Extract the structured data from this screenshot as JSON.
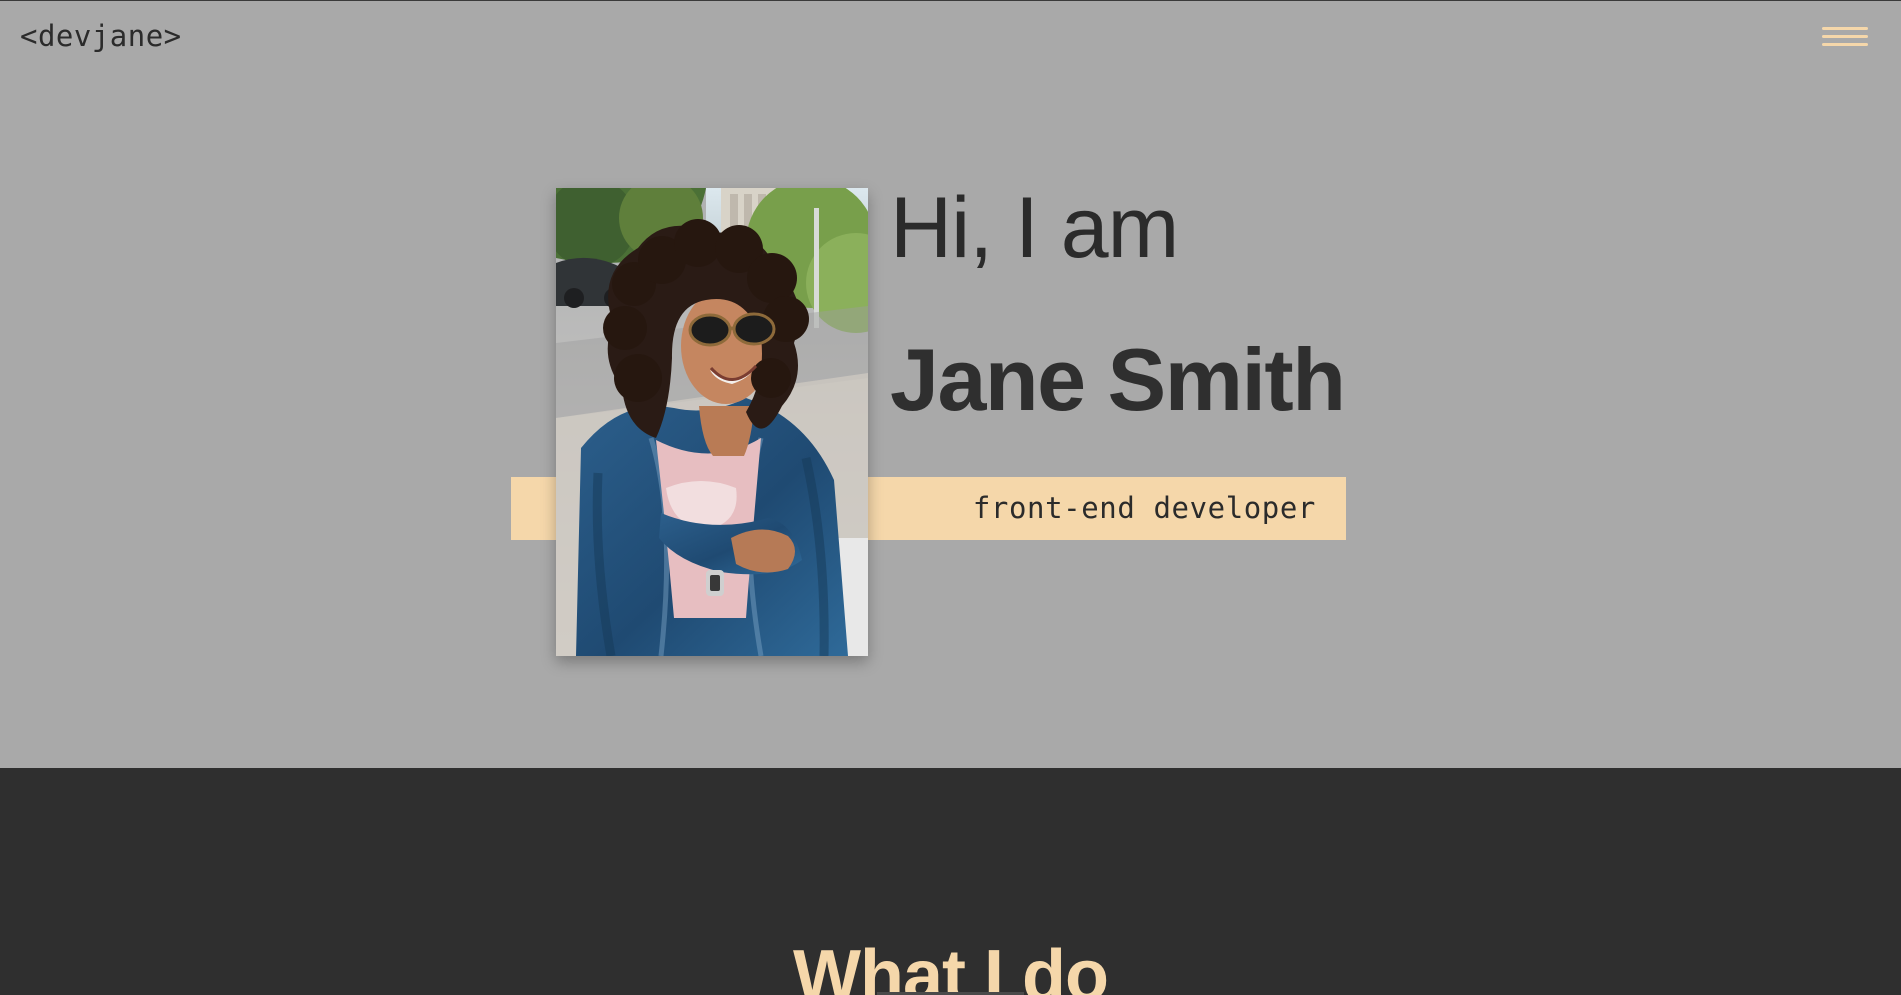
{
  "header": {
    "logo_text": "<devjane>",
    "menu_icon": "hamburger-menu-icon"
  },
  "hero": {
    "greeting": "Hi, I am",
    "name": "Jane Smith",
    "role": "front-end developer",
    "photo_alt": "Portrait of Jane Smith smiling outdoors wearing sunglasses and a denim jacket"
  },
  "services": {
    "title": "What I do"
  },
  "colors": {
    "hero_background": "#a9a9a9",
    "dark_background": "#2f2f2f",
    "accent": "#f5d7aa",
    "text_dark": "#2b2b2b"
  }
}
